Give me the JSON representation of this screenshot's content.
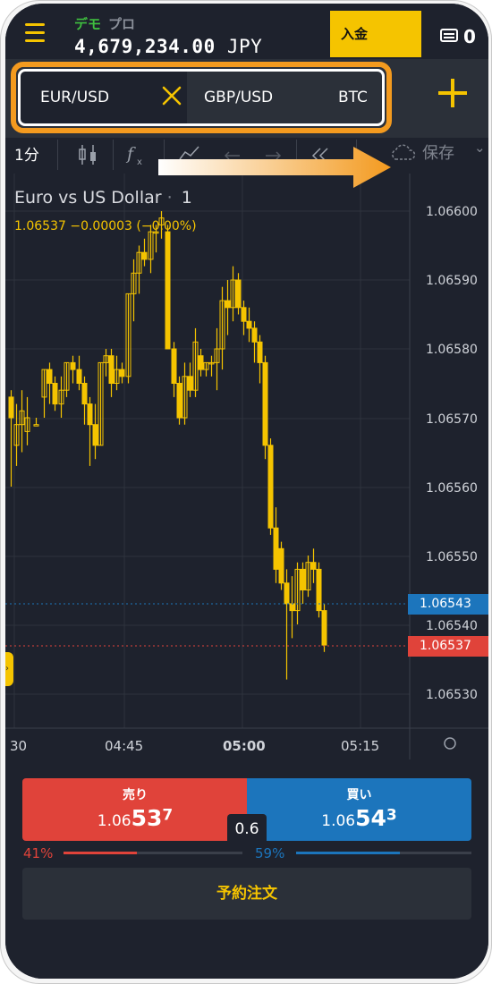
{
  "header": {
    "mode_demo": "デモ",
    "mode_pro": "プロ",
    "balance_amount": "4,679,234.00",
    "balance_currency": "JPY",
    "deposit_label": "入金",
    "wallet_count": "0"
  },
  "tabs": [
    {
      "label": "EUR/USD",
      "active": true
    },
    {
      "label": "GBP/USD",
      "active": false
    },
    {
      "label": "BTC",
      "active": false
    }
  ],
  "toolbar": {
    "timeframe": "1分",
    "save_label": "保存"
  },
  "chart": {
    "symbol": "Euro vs US Dollar",
    "timeframe": "1",
    "ohlc_line": "1.06537  −0.00003 (−0.00%)",
    "price_axis": [
      "1.06600",
      "1.06590",
      "1.06580",
      "1.06570",
      "1.06560",
      "1.06550",
      "1.06540",
      "1.06530"
    ],
    "time_axis": [
      {
        "label": "30",
        "bold": false
      },
      {
        "label": "04:45",
        "bold": false
      },
      {
        "label": "05:00",
        "bold": true
      },
      {
        "label": "05:15",
        "bold": false
      }
    ],
    "ask_tag": "1.06543",
    "bid_tag": "1.06537",
    "colors": {
      "candle": "#f5c400",
      "ask": "#1c75bc",
      "bid": "#e0433a",
      "grid": "#2e333d"
    }
  },
  "order": {
    "sell_label": "売り",
    "sell_price_prefix": "1.06",
    "sell_price_main": "53",
    "sell_price_sup": "7",
    "buy_label": "買い",
    "buy_price_prefix": "1.06",
    "buy_price_main": "54",
    "buy_price_sup": "3",
    "spread": "0.6",
    "sell_pct": "41%",
    "buy_pct": "59%",
    "sell_ratio": 0.41,
    "buy_ratio": 0.59,
    "reserve_label": "予約注文"
  }
}
